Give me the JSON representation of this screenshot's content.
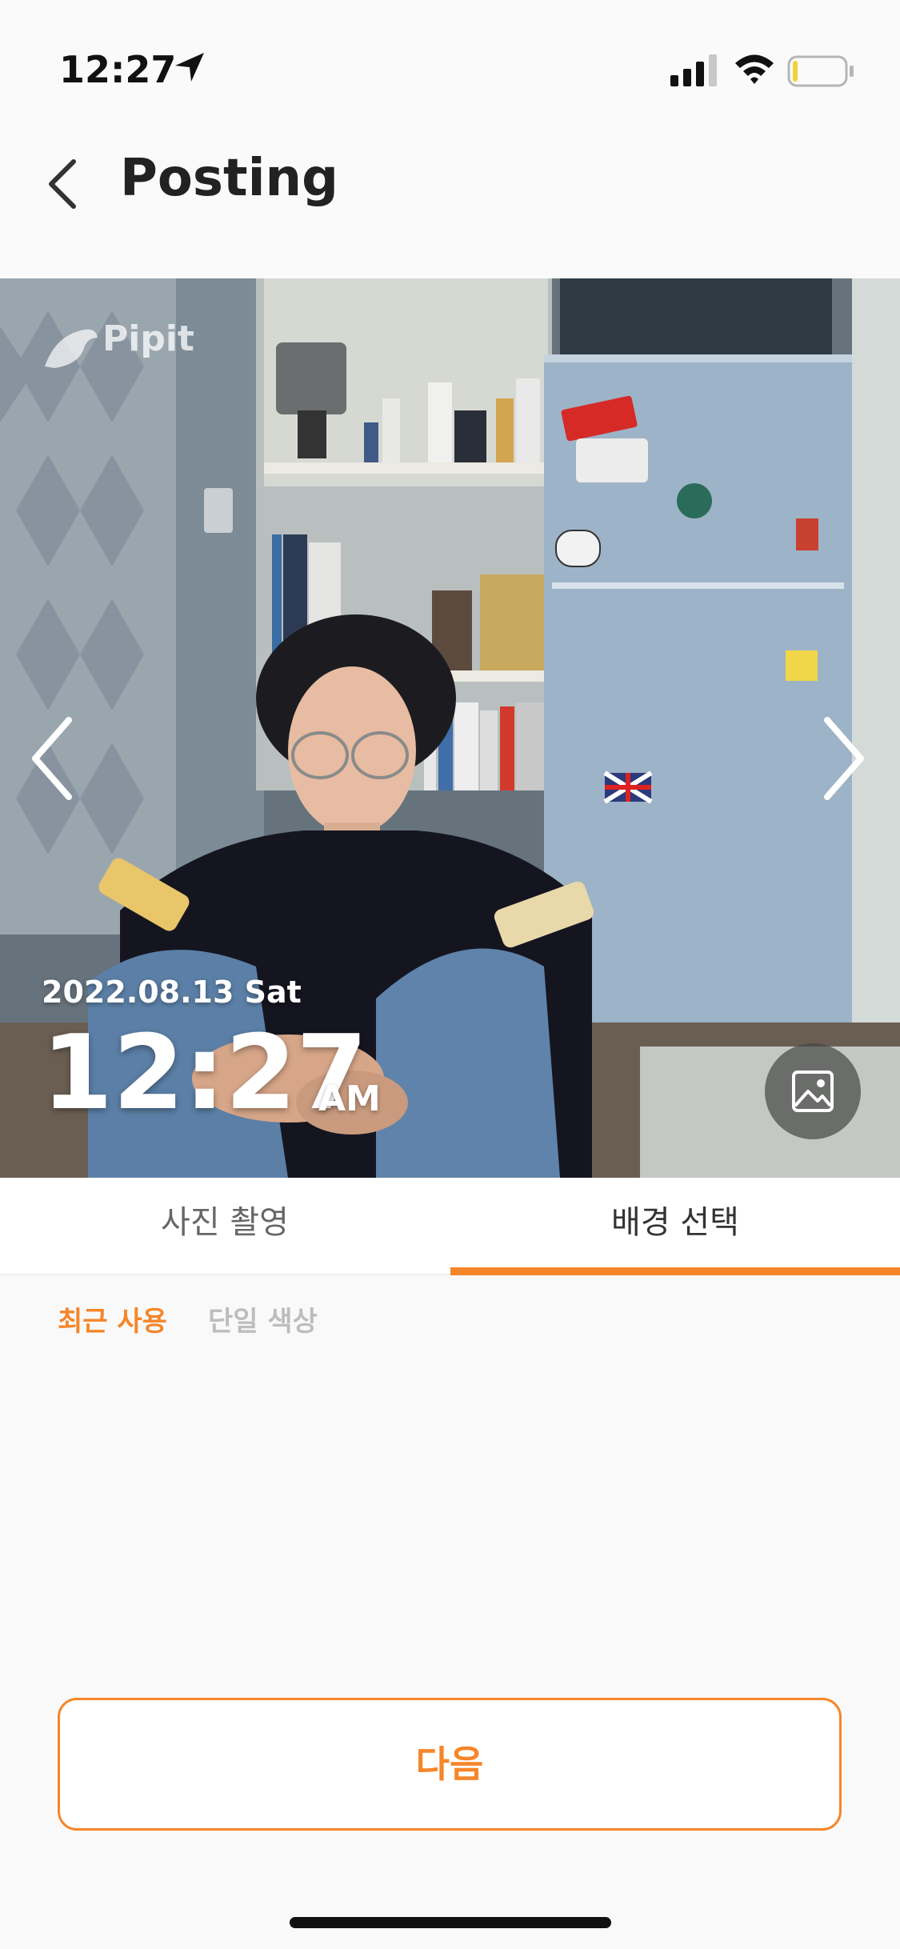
{
  "status_bar": {
    "time": "12:27"
  },
  "header": {
    "title": "Posting"
  },
  "photo": {
    "brand": "Pipit",
    "date": "2022.08.13 Sat",
    "time": "12:27",
    "ampm": "AM"
  },
  "tabs": [
    {
      "label": "사진 촬영",
      "selected": false
    },
    {
      "label": "배경 선택",
      "selected": true
    }
  ],
  "subtabs": [
    {
      "label": "최근 사용",
      "selected": true
    },
    {
      "label": "단일 색상",
      "selected": false
    }
  ],
  "next_button": {
    "label": "다음"
  },
  "colors": {
    "accent": "#f5862a",
    "inactive_subtab": "#bdbdbd"
  }
}
